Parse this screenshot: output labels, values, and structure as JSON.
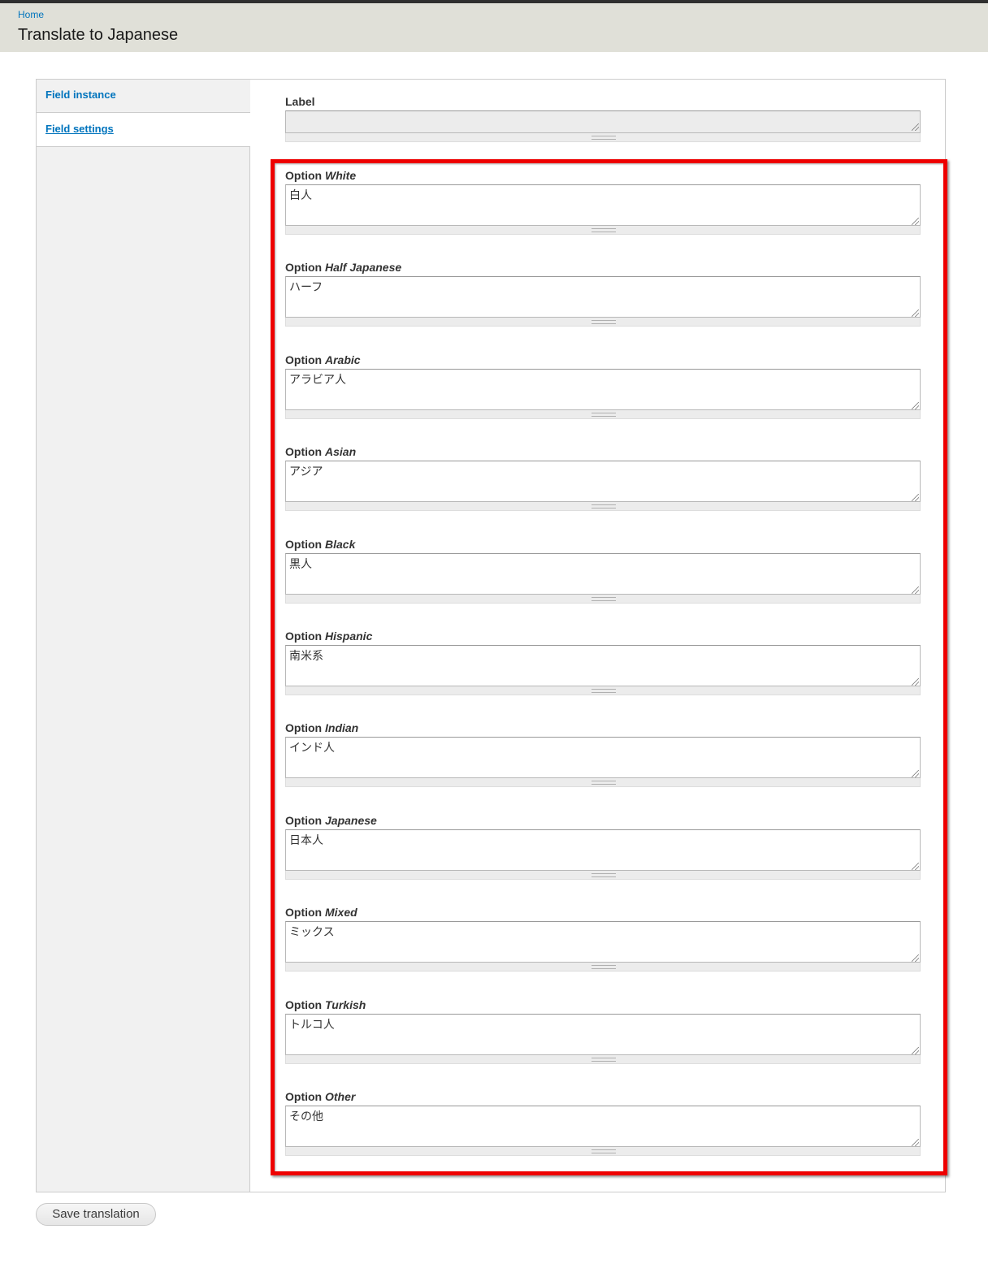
{
  "header": {
    "breadcrumb": "Home",
    "title": "Translate to Japanese"
  },
  "tabs": [
    {
      "label": "Field instance",
      "active": false
    },
    {
      "label": "Field settings",
      "active": true
    }
  ],
  "label_field": {
    "label": "Label",
    "value": ""
  },
  "options": [
    {
      "prefix": "Option",
      "name": "White",
      "value": "白人"
    },
    {
      "prefix": "Option",
      "name": "Half Japanese",
      "value": "ハーフ"
    },
    {
      "prefix": "Option",
      "name": "Arabic",
      "value": "アラビア人"
    },
    {
      "prefix": "Option",
      "name": "Asian",
      "value": "アジア"
    },
    {
      "prefix": "Option",
      "name": "Black",
      "value": "黒人"
    },
    {
      "prefix": "Option",
      "name": "Hispanic",
      "value": "南米系"
    },
    {
      "prefix": "Option",
      "name": "Indian",
      "value": "インド人"
    },
    {
      "prefix": "Option",
      "name": "Japanese",
      "value": "日本人"
    },
    {
      "prefix": "Option",
      "name": "Mixed",
      "value": "ミックス"
    },
    {
      "prefix": "Option",
      "name": "Turkish",
      "value": "トルコ人"
    },
    {
      "prefix": "Option",
      "name": "Other",
      "value": "その他"
    }
  ],
  "actions": {
    "save_label": "Save translation"
  },
  "colors": {
    "link": "#0074bd",
    "header_bg": "#e0e0d8",
    "highlight": "#ee0000"
  }
}
